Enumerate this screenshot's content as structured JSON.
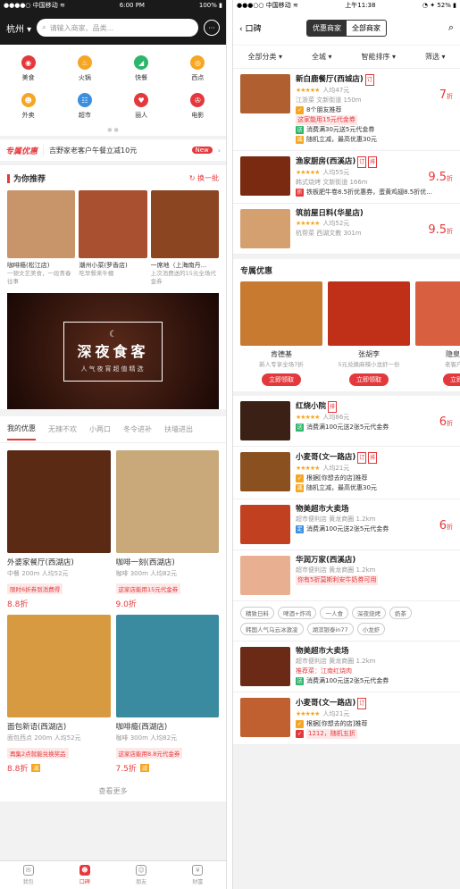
{
  "left": {
    "status": {
      "carrier": "●●●●○ 中国移动 ≋",
      "time": "6:00 PM",
      "battery": "100% ▮"
    },
    "header": {
      "city": "杭州 ▾",
      "search_placeholder": "请输入商家、品类..."
    },
    "categories": [
      {
        "label": "美食",
        "icon": "food-icon",
        "color": "#e4393c",
        "glyph": "◉"
      },
      {
        "label": "火锅",
        "icon": "hotpot-icon",
        "color": "#f5a623",
        "glyph": "♨"
      },
      {
        "label": "快餐",
        "icon": "fastfood-icon",
        "color": "#2db56b",
        "glyph": "◢"
      },
      {
        "label": "西点",
        "icon": "dessert-icon",
        "color": "#f5a623",
        "glyph": "◎"
      },
      {
        "label": "外卖",
        "icon": "delivery-icon",
        "color": "#f5a623",
        "glyph": "☻"
      },
      {
        "label": "超市",
        "icon": "supermarket-icon",
        "color": "#3b8fde",
        "glyph": "☷"
      },
      {
        "label": "丽人",
        "icon": "beauty-icon",
        "color": "#e4393c",
        "glyph": "♥"
      },
      {
        "label": "电影",
        "icon": "movie-icon",
        "color": "#e4393c",
        "glyph": "✇"
      }
    ],
    "page_dots": "● ●",
    "promo": {
      "label": "专属优惠",
      "text": "吉野家老客户午餐立减10元",
      "badge": "New",
      "arrow": "›"
    },
    "recommend": {
      "title": "为你推荐",
      "refresh": "↻ 换一批",
      "items": [
        {
          "name": "咖啡瘾(松江店)",
          "desc": "一顿文艺美食，一段青春往事",
          "img": "#c8956a"
        },
        {
          "name": "潮州小菜(罗香店)",
          "desc": "吃早餐来牛棚",
          "img": "#a85030"
        },
        {
          "name": "一席地（上海南丹...",
          "desc": "上次消费送的15元全场代金券",
          "img": "#8b4520"
        }
      ]
    },
    "banner": {
      "moon": "☾",
      "title": "深夜食客",
      "subtitle": "人气夜宵超值精选"
    },
    "tabs": [
      "我的优惠",
      "无辣不欢",
      "小两口",
      "冬令进补",
      "扶墙进出"
    ],
    "deals": [
      {
        "name": "外婆家餐厅(西湖店)",
        "meta": "中餐  200m  人均52元",
        "tag": "限时6折券到消费得",
        "disc": "8.8折",
        "img": "#5a2a15",
        "mini": ""
      },
      {
        "name": "咖啡一刻(西湖店)",
        "meta": "咖啡  300m  人均82元",
        "tag": "这家店能用15元代金券",
        "disc": "9.0折",
        "img": "#c9a87a",
        "mini": ""
      },
      {
        "name": "面包新语(西湖店)",
        "meta": "面包西点  200m  人均52元",
        "tag": "再集2点就能兑换奖品",
        "disc": "8.8折",
        "img": "#d89a40",
        "mini": "减"
      },
      {
        "name": "咖啡瘾(西湖店)",
        "meta": "咖啡  300m  人均82元",
        "tag": "这家店能用8.8元代金券",
        "disc": "7.5折",
        "img": "#3a8aa0",
        "mini": "减"
      }
    ],
    "more": "查看更多",
    "nav": [
      {
        "label": "我包",
        "icon": "wallet-icon",
        "glyph": "✉",
        "active": false
      },
      {
        "label": "口碑",
        "icon": "koubei-icon",
        "glyph": "☻",
        "active": true
      },
      {
        "label": "朋友",
        "icon": "friends-icon",
        "glyph": "☺",
        "active": false
      },
      {
        "label": "财富",
        "icon": "wealth-icon",
        "glyph": "¥",
        "active": false
      }
    ]
  },
  "right": {
    "status": {
      "carrier": "●●●○○ 中国移动 ≋",
      "time": "上午11:38",
      "battery": "◔ ✦ 52% ▮"
    },
    "header": {
      "back": "‹ 口碑",
      "seg": [
        "优惠商家",
        "全部商家"
      ]
    },
    "filters": [
      "全部分类 ▾",
      "全城 ▾",
      "智能排序 ▾",
      "筛选 ▾"
    ],
    "shops1": [
      {
        "name": "新白鹿餐厅(西城店)",
        "badges": [
          "订"
        ],
        "stars": "★★★★★",
        "price": "人均47元",
        "loc": "江浙菜  文新街道  150m",
        "lines": [
          {
            "i": "",
            "c": "o",
            "t": "8个朋友推荐"
          },
          {
            "i": "",
            "c": "",
            "t": "这家能用15元代金券",
            "red": true
          },
          {
            "i": "送",
            "c": "g",
            "t": "消费满30元送5元代金券"
          },
          {
            "i": "减",
            "c": "o",
            "t": "随机立减，最高优惠30元"
          }
        ],
        "disc": "7",
        "img": "#b06030"
      },
      {
        "name": "渔家厨房(西溪店)",
        "badges": [
          "订",
          "排"
        ],
        "stars": "★★★★★",
        "price": "人均55元",
        "loc": "韩式烧烤  文新街道  166m",
        "lines": [
          {
            "i": "折",
            "c": "r",
            "t": "铁板肥牛卷8.5折优惠券，蛋黄鸡翅8.5折优..."
          }
        ],
        "disc": "9.5",
        "img": "#7a2a10"
      },
      {
        "name": "筑前屋日料(华星店)",
        "badges": [],
        "stars": "★★★★★",
        "price": "人均52元",
        "loc": "杭帮菜  西湖文教  301m",
        "lines": [],
        "disc": "9.5",
        "img": "#d4a070"
      }
    ],
    "exclusive": {
      "title": "专属优惠",
      "items": [
        {
          "name": "肯德基",
          "desc": "新人专享全场7折",
          "btn": "立即领取",
          "img": "#c87a30"
        },
        {
          "name": "张胡李",
          "desc": "5元兑换麻辣小龙虾一份",
          "btn": "立即领取",
          "img": "#c03018"
        },
        {
          "name": "隐泉日",
          "desc": "老客户专",
          "btn": "立即",
          "img": "#d86040"
        }
      ]
    },
    "shops2": [
      {
        "name": "红烧小院",
        "badges": [
          "排"
        ],
        "stars": "★★★★★",
        "price": "人均86元",
        "loc": "",
        "lines": [
          {
            "i": "送",
            "c": "g",
            "t": "消费满100元送2张5元代金券"
          }
        ],
        "disc": "6",
        "img": "#3a2015"
      },
      {
        "name": "小麦哥(文一路店)",
        "badges": [
          "订",
          "排"
        ],
        "stars": "★★★★★",
        "price": "人均21元",
        "loc": "",
        "lines": [
          {
            "i": "",
            "c": "o",
            "t": "根据[你想去的店]推荐"
          },
          {
            "i": "减",
            "c": "o",
            "t": "随机立减，最高优惠30元"
          }
        ],
        "disc": "",
        "img": "#8a5020"
      },
      {
        "name": "物美超市大卖场",
        "badges": [],
        "stars": "",
        "price": "",
        "loc": "超市便利店  黄龙商圈  1.2km",
        "lines": [
          {
            "i": "定",
            "c": "b",
            "t": "消费满100元送2张5元代金券"
          }
        ],
        "disc": "6",
        "img": "#c04020"
      },
      {
        "name": "华润万家(西溪店)",
        "badges": [],
        "stars": "",
        "price": "",
        "loc": "超市便利店  黄龙商圈  1.2km",
        "lines": [
          {
            "i": "",
            "c": "",
            "t": "你有5折莫斯利安牛奶券可用",
            "red": true
          }
        ],
        "disc": "",
        "img": "#e8b090"
      }
    ],
    "keywords": [
      "精致日料",
      "啤酒+炸鸡",
      "一人食",
      "深夜烧烤",
      "奶茶",
      "韩国人气乌云冰激凌",
      "湖滨银泰in77",
      "小龙虾"
    ],
    "shops3": [
      {
        "name": "物美超市大卖场",
        "badges": [],
        "stars": "",
        "price": "",
        "loc": "超市便利店  黄龙商圈  1.2km",
        "lines": [
          {
            "i": "",
            "c": "",
            "t": "推荐菜：江南红烧肉",
            "redtxt": true
          },
          {
            "i": "送",
            "c": "g",
            "t": "消费满100元送2张5元代金券"
          }
        ],
        "disc": "",
        "img": "#6a2a15"
      },
      {
        "name": "小麦哥(文一路店)",
        "badges": [
          "订"
        ],
        "stars": "★★★★★",
        "price": "人均21元",
        "loc": "",
        "lines": [
          {
            "i": "",
            "c": "o",
            "t": "根据[你想去的店]推荐"
          },
          {
            "i": "",
            "c": "r",
            "t": "1212，随机五折",
            "red": true
          }
        ],
        "disc": "",
        "img": "#c06030"
      }
    ]
  }
}
